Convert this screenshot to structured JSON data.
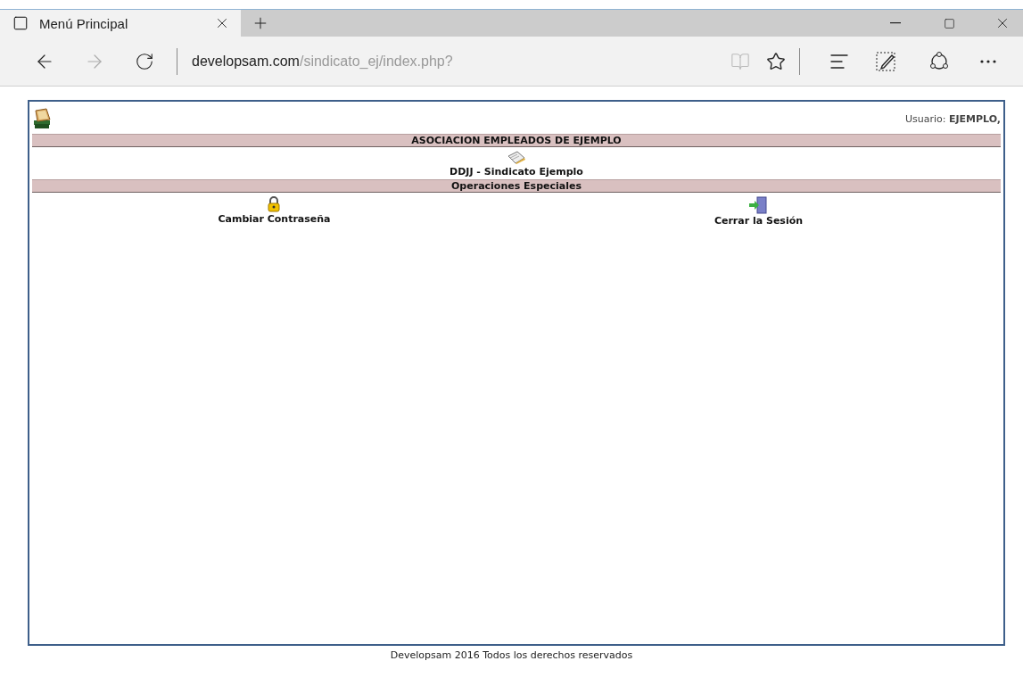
{
  "browser": {
    "tab": {
      "title": "Menú Principal",
      "selected": true
    },
    "url_host": "developsam.com",
    "url_path": "/sindicato_ej/index.php?",
    "reading_view_disabled": true,
    "forward_disabled": true
  },
  "page": {
    "user": "Usuario: **EJEMPLO,**",
    "sections": [
      {
        "title": "ASOCIACION EMPLEADOS DE EJEMPLO",
        "items": [
          {
            "label": "DDJJ - Sindicato Ejemplo",
            "kind": "notepad"
          }
        ]
      },
      {
        "title": "Operaciones Especiales",
        "items": [
          {
            "label": "Cambiar Contraseña",
            "kind": "lock"
          },
          {
            "label": "Cerrar la Sesión",
            "kind": "exit"
          }
        ]
      }
    ],
    "footer": "Developsam 2016 Todos los derechos reservados"
  }
}
